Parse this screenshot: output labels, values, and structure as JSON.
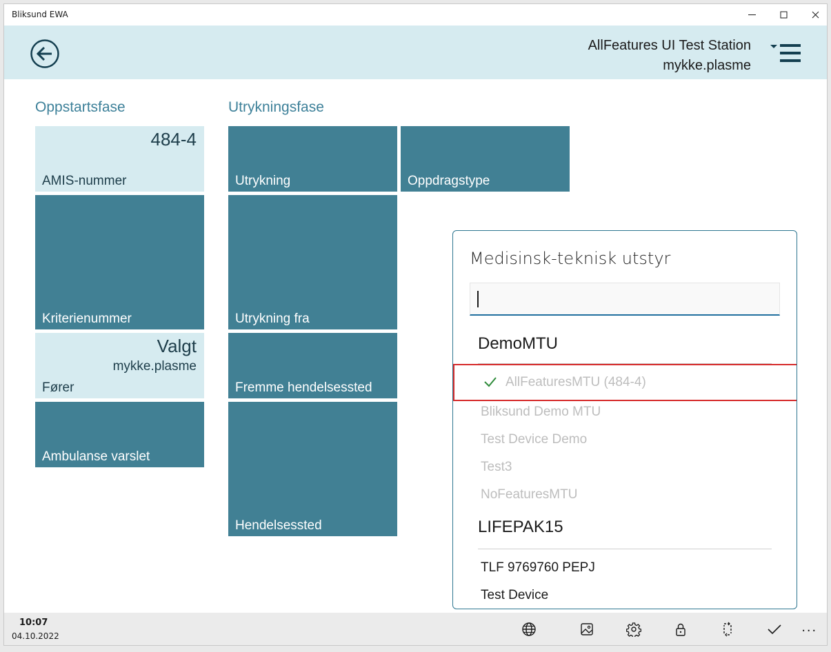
{
  "window": {
    "title": "Bliksund EWA"
  },
  "header": {
    "station_name": "AllFeatures UI Test Station",
    "user": "mykke.plasme"
  },
  "sections": {
    "oppstart_title": "Oppstartsfase",
    "utrykning_title": "Utrykningsfase"
  },
  "tiles": {
    "amis": {
      "value": "484-4",
      "label": "AMIS-nummer"
    },
    "kriterie": {
      "label": "Kriterienummer"
    },
    "forer": {
      "value": "Valgt",
      "sub": "mykke.plasme",
      "label": "Fører"
    },
    "ambulanse": {
      "label": "Ambulanse varslet"
    },
    "utrykning": {
      "label": "Utrykning"
    },
    "oppdragstype": {
      "label": "Oppdragstype"
    },
    "utrykning_fra": {
      "label": "Utrykning fra"
    },
    "fremme": {
      "label": "Fremme hendelsessted"
    },
    "hendelsessted": {
      "label": "Hendelsessted"
    }
  },
  "popup": {
    "title": "Medisinsk-teknisk utstyr",
    "search_value": "",
    "groups": [
      {
        "name": "DemoMTU",
        "items": [
          "AllFeaturesMTU (484-4)",
          "Bliksund Demo MTU",
          "Test Device Demo",
          "Test3",
          "NoFeaturesMTU"
        ]
      },
      {
        "name": "LIFEPAK15",
        "items": [
          "TLF 9769760 PEPJ",
          "Test Device"
        ]
      }
    ]
  },
  "taskbar": {
    "time": "10:07",
    "date": "04.10.2022",
    "more": "..."
  },
  "colors": {
    "tile_dark": "#418094",
    "tile_light": "#d6ebf0",
    "accent": "#3d8099",
    "selection_border": "#d62a2a"
  }
}
